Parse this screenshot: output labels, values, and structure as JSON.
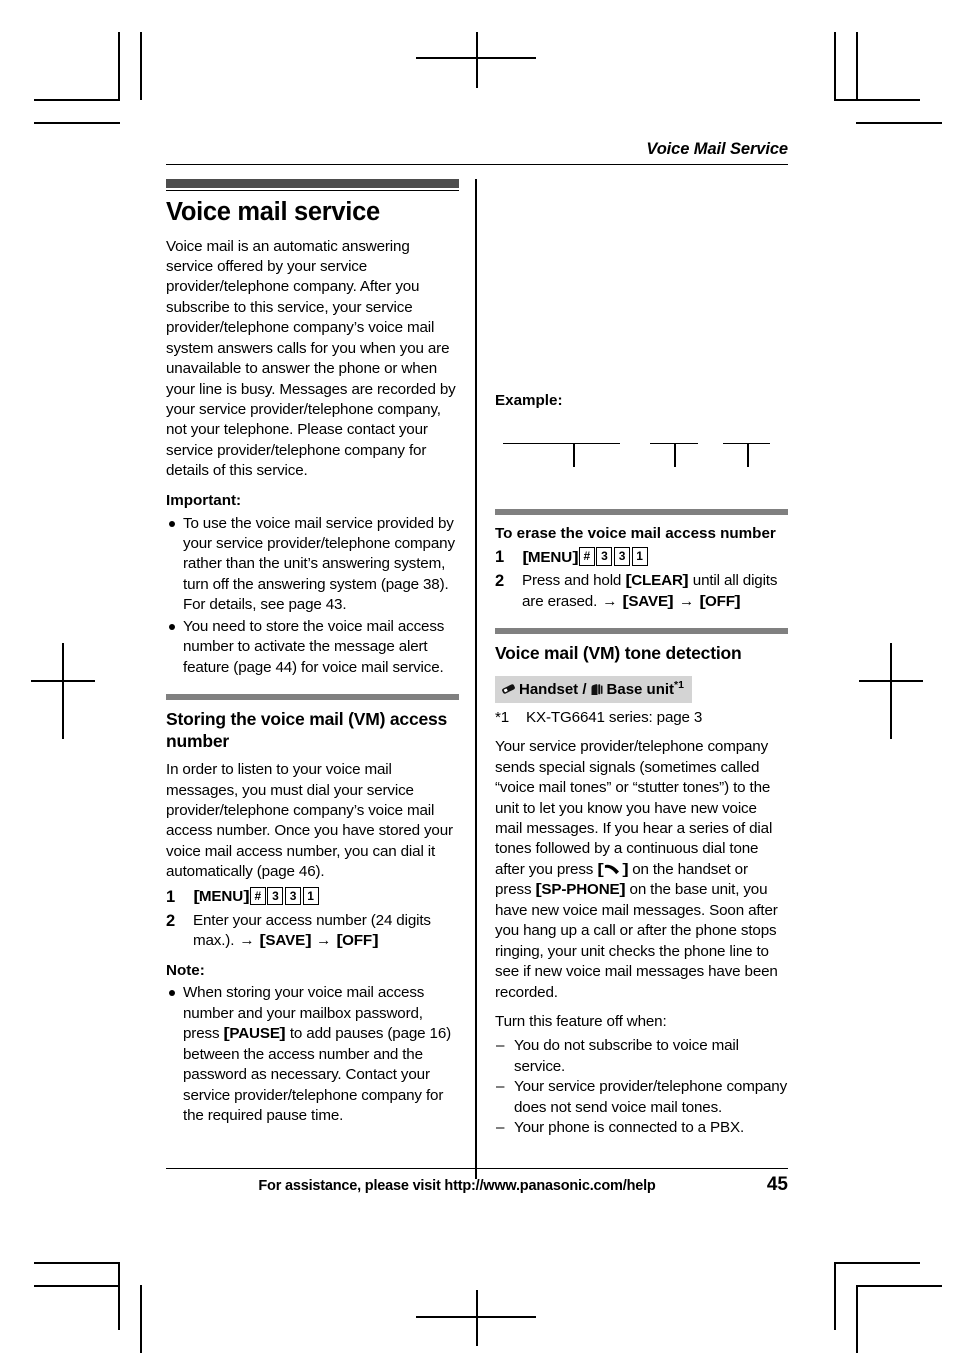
{
  "running_head": "Voice Mail Service",
  "chapter": {
    "title": "Voice mail service",
    "intro": "Voice mail is an automatic answering service offered by your service provider/telephone company. After you subscribe to this service, your service provider/telephone company’s voice mail system answers calls for you when you are unavailable to answer the phone or when your line is busy. Messages are recorded by your service provider/telephone company, not your telephone. Please contact your service provider/telephone company for details of this service."
  },
  "important": {
    "label": "Important:",
    "items": [
      "To use the voice mail service provided by your service provider/telephone company rather than the unit’s answering system, turn off the answering system (page 38). For details, see page 43.",
      "You need to store the voice mail access number to activate the message alert feature (page 44) for voice mail service."
    ]
  },
  "storing": {
    "title": "Storing the voice mail (VM) access number",
    "intro": "In order to listen to your voice mail messages, you must dial your service provider/telephone company’s voice mail access number. Once you have stored your voice mail access number, you can dial it automatically (page 46).",
    "step1": {
      "menu_key": "MENU",
      "boxed_keys": [
        "#",
        "3",
        "3",
        "1"
      ]
    },
    "step2": {
      "text_before": "Enter your access number (24 digits max.).",
      "arrow": "→",
      "key_save": "SAVE",
      "key_off": "OFF"
    }
  },
  "note": {
    "label": "Note:",
    "items": [
      {
        "part1": "When storing your voice mail access number and your mailbox password, press ",
        "key": "PAUSE",
        "part2": " to add pauses (page 16) between the access number and the password as necessary. Contact your service provider/telephone company for the required pause time."
      }
    ]
  },
  "example": {
    "label": "Example:",
    "caption": ""
  },
  "erase": {
    "title": "To erase the voice mail access number",
    "step1": {
      "menu_key": "MENU",
      "boxed_keys": [
        "#",
        "3",
        "3",
        "1"
      ]
    },
    "step2": {
      "text_before": "Press and hold ",
      "key_clear": "CLEAR",
      "text_after": " until all digits are erased.",
      "arrow": "→",
      "key_save": "SAVE",
      "key_off": "OFF"
    }
  },
  "tone_detection": {
    "title": "Voice mail (VM) tone detection",
    "badge": {
      "handset_icon": "handset-icon",
      "handset_label": "Handset",
      "separator": "/",
      "baseunit_icon": "base-unit-icon",
      "baseunit_label": "Base unit",
      "footnote_ref": "*1"
    },
    "footnote": {
      "mark": "*1",
      "text": "KX-TG6641 series: page 3"
    },
    "body_part1": "Your service provider/telephone company sends special signals (sometimes called “voice mail tones” or “stutter tones”) to the unit to let you know you have new voice mail messages. If you hear a series of dial tones followed by a continuous dial tone after you press ",
    "talk_key_icon": "talk-key-icon",
    "body_part2": " on the handset or press ",
    "key_spphone": "SP-PHONE",
    "body_part3": " on the base unit, you have new voice mail messages. Soon after you hang up a call or after the phone stops ringing, your unit checks the phone line to see if new voice mail messages have been recorded.",
    "turn_off_label": "Turn this feature off when:",
    "turn_off_items": [
      "You do not subscribe to voice mail service.",
      "Your service provider/telephone company does not send voice mail tones.",
      "Your phone is connected to a PBX."
    ]
  },
  "footer": {
    "text": "For assistance, please visit http://www.panasonic.com/help",
    "page_number": "45"
  },
  "colors": {
    "chapter_bar": "#4d4d4d",
    "section_bar": "#808080",
    "badge_bg": "#d4d4d4"
  }
}
